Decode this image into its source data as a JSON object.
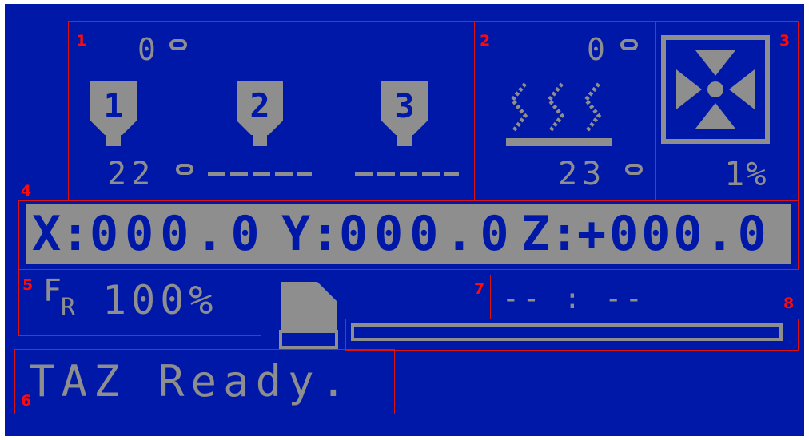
{
  "sections": {
    "hotends": "1",
    "bed": "2",
    "fan": "3",
    "position": "4",
    "feedrate": "5",
    "status": "6",
    "print_time": "7",
    "progress": "8"
  },
  "hotends": {
    "target_temp": "0",
    "current_temp": "22",
    "labels": [
      "1",
      "2",
      "3"
    ],
    "e2_temp": "-----",
    "e3_temp": "-----"
  },
  "bed": {
    "target_temp": "0",
    "current_temp": "23"
  },
  "fan": {
    "speed": "1%"
  },
  "position": {
    "x": "000.0",
    "y": "000.0",
    "z": "+000.0"
  },
  "feedrate": {
    "label_main": "F",
    "label_sub": "R",
    "value": "100%"
  },
  "print_time": {
    "value": "-- : --"
  },
  "progress": {
    "fraction": 0
  },
  "status": {
    "message": "TAZ Ready."
  },
  "colors": {
    "background": "#0018a8",
    "pixel": "#8e8e8e",
    "annotation": "#e01010"
  },
  "icons": [
    "hotend-icon",
    "bed-heat-icon",
    "fan-icon",
    "sd-card-icon",
    "degree-icon"
  ]
}
